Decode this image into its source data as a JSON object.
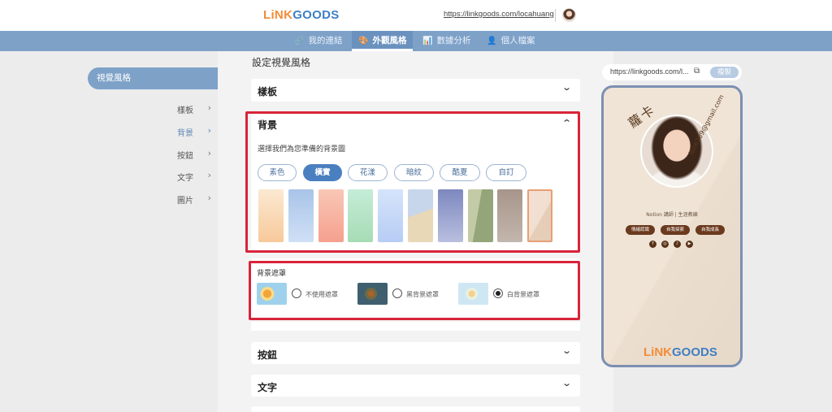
{
  "header": {
    "logo_part1": "LiNK",
    "logo_part2": "GOODS",
    "site_url": "https://linkgoods.com/locahuang"
  },
  "nav": {
    "items": [
      {
        "icon": "🔗",
        "label": "我的連結"
      },
      {
        "icon": "🎨",
        "label": "外觀風格"
      },
      {
        "icon": "📊",
        "label": "數據分析"
      },
      {
        "icon": "👤",
        "label": "個人檔案"
      }
    ],
    "active_index": 1
  },
  "sidebar": {
    "active_label": "視覺風格",
    "items": [
      {
        "label": "樣板"
      },
      {
        "label": "背景"
      },
      {
        "label": "按鈕"
      },
      {
        "label": "文字"
      },
      {
        "label": "圖片"
      }
    ],
    "selected_index": 1,
    "chevron": "›"
  },
  "main": {
    "section_title": "設定視覺風格",
    "accordions": {
      "template": "樣板",
      "background": "背景",
      "button": "按鈕",
      "text": "文字"
    },
    "chevron_down": "⌄",
    "chevron_up": "⌃"
  },
  "background": {
    "description": "選擇我們為您準備的背景圖",
    "tabs": [
      "素色",
      "橫實",
      "花漾",
      "暗紋",
      "酷夏",
      "自訂"
    ],
    "selected_tab": 1,
    "swatch_colors": [
      [
        "#fbe9d2",
        "#f7c99a"
      ],
      [
        "#a9c4e8",
        "#cfe0f5"
      ],
      [
        "#f9c7b6",
        "#f6a08e"
      ],
      [
        "#c5ecd7",
        "#a6dcb5"
      ],
      [
        "#d5e4fb",
        "#b7ccf5"
      ],
      [
        "#c7d6ea",
        "#e8d8b8"
      ],
      [
        "#7d88bf",
        "#b9bfdf"
      ],
      [
        "#c3cba6",
        "#94a679"
      ],
      [
        "#a7958a",
        "#c3b6ad"
      ],
      [
        "#f1dfd1",
        "#e6cdb8"
      ]
    ],
    "selected_swatch": 9
  },
  "mask": {
    "title": "背景遮罩",
    "options": [
      {
        "label": "不使用遮罩"
      },
      {
        "label": "黑背景遮罩"
      },
      {
        "label": "白背景遮罩"
      }
    ],
    "selected": 2
  },
  "preview": {
    "url": "https://linkgoods.com/l...",
    "copy_label": "複製",
    "name": "蘿卡",
    "email": "l606289@gmail.com",
    "role": "Notion 講師 | 生涯教練",
    "chips": [
      "情緒認識",
      "自我探索",
      "自我成長"
    ],
    "socials": [
      "facebook-icon",
      "instagram-icon",
      "podcast-icon",
      "youtube-icon"
    ],
    "social_glyphs": [
      "f",
      "◎",
      "♪",
      "▶"
    ],
    "logo_part1": "LiNK",
    "logo_part2": "GOODS"
  },
  "colors": {
    "accent": "#7ea1c8",
    "highlight_border": "#d8243a",
    "primary_tab": "#4a7fc0"
  }
}
